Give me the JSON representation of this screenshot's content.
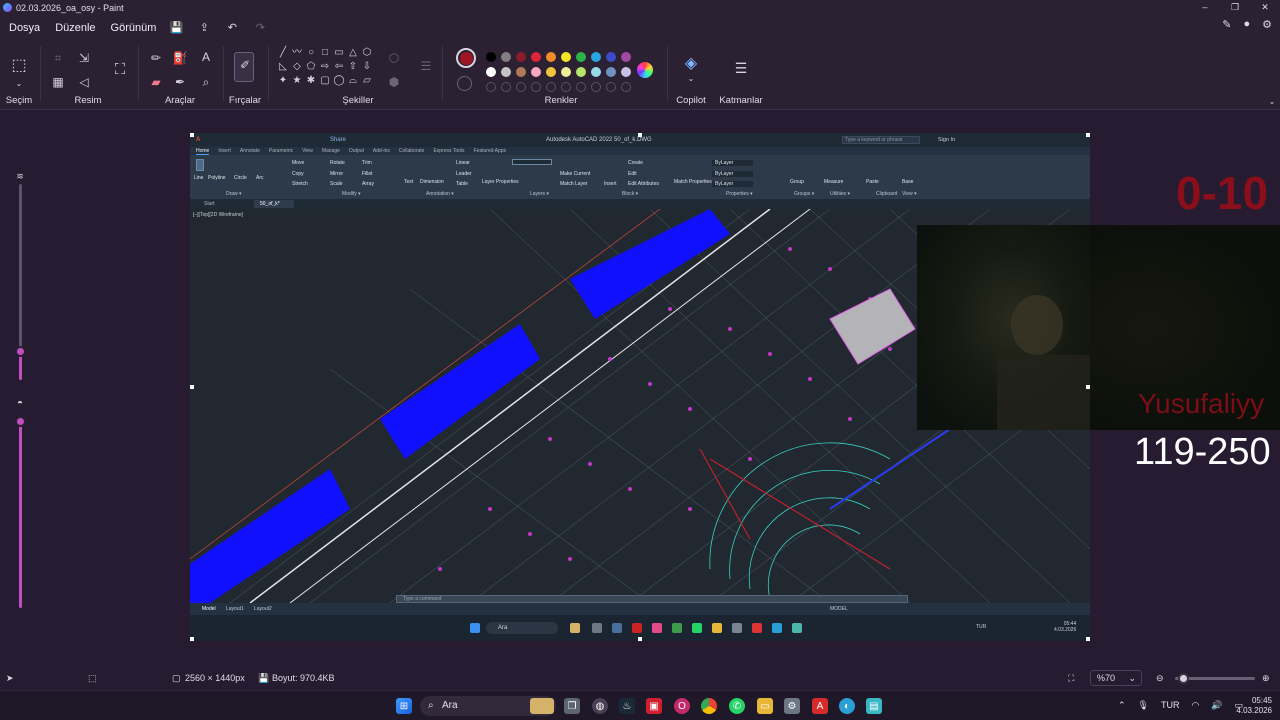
{
  "window": {
    "title": "02.03.2026_oa_osy - Paint",
    "controls": [
      "–",
      "❐",
      "✕"
    ]
  },
  "menu": {
    "items": [
      "Dosya",
      "Düzenle",
      "Görünüm"
    ]
  },
  "ribbon": {
    "groups": {
      "selection": "Seçim",
      "image": "Resim",
      "tools": "Araçlar",
      "brushes": "Fırçalar",
      "shapes": "Şekiller",
      "colors": "Renkler",
      "copilot": "Copilot",
      "layers": "Katmanlar"
    },
    "shape_glyphs": [
      "╱",
      "〰",
      "○",
      "□",
      "▭",
      "△",
      "⬡",
      "◺",
      "◇",
      "⬠",
      "⇨",
      "⇦",
      "⇧",
      "⇩",
      "✦",
      "★",
      "✱",
      "▢",
      "◯",
      "⌓",
      "▱"
    ],
    "primary_color": "#a01428",
    "palette": [
      "#000000",
      "#808080",
      "#8b1a2b",
      "#e0243a",
      "#f28c28",
      "#f7e425",
      "#2cb34a",
      "#27a7e0",
      "#3e4bc8",
      "#a348a3",
      "#ffffff",
      "#c3c3c3",
      "#b07a57",
      "#f7a8c2",
      "#f5c33b",
      "#f0ec9a",
      "#b5e56b",
      "#99d9ea",
      "#7092be",
      "#c8bfe7"
    ]
  },
  "canvas": {
    "autocad": {
      "title": "Autodesk AutoCAD 2022   50_of_k.DWG",
      "search_placeholder": "Type a keyword or phrase",
      "signin": "Sign In",
      "share": "Share",
      "tabs": [
        "Home",
        "Insert",
        "Annotate",
        "Parametric",
        "View",
        "Manage",
        "Output",
        "Add-ins",
        "Collaborate",
        "Express Tools",
        "Featured Apps"
      ],
      "ribbon_groups": [
        "Draw ▾",
        "Modify ▾",
        "Annotation ▾",
        "Layers ▾",
        "Block ▾",
        "Properties ▾",
        "Groups ▾",
        "Utilities ▾",
        "Clipboard",
        "View ▾"
      ],
      "draw_items": [
        "Line",
        "Polyline",
        "Circle",
        "Arc"
      ],
      "modify_items": [
        "Move",
        "Rotate",
        "Trim",
        "Copy",
        "Mirror",
        "Fillet",
        "Stretch",
        "Scale",
        "Array"
      ],
      "annotation_items": [
        "Text",
        "Dimension",
        "Linear",
        "Leader",
        "Table"
      ],
      "layer_items": [
        "Layer Properties",
        "Make Current",
        "Match Layer"
      ],
      "block_items": [
        "Insert",
        "Create",
        "Edit",
        "Edit Attributes"
      ],
      "properties_items": [
        "Match Properties",
        "ByLayer",
        "ByLayer",
        "ByLayer"
      ],
      "other_items": [
        "Group",
        "Measure",
        "Paste",
        "Base"
      ],
      "doc_tabs": {
        "start": "Start",
        "file": "50_of_k*"
      },
      "view_label": "[–][Top][2D Wireframe]",
      "command_placeholder": "Type a command",
      "layout_tabs": [
        "Model",
        "Layout1",
        "Layout2"
      ],
      "status_model": "MODEL",
      "taskbar_search": "Ara",
      "taskbar_lang": "TUR",
      "clock_time": "05:44",
      "clock_date": "4.03.2026"
    },
    "overlay_texts": {
      "range_top": "0-10",
      "name": "Yusufaliyy",
      "range_mid": "119-250"
    }
  },
  "statusbar": {
    "dimensions": "2560 × 1440px",
    "size": "Boyut: 970.4KB",
    "zoom": "%70"
  },
  "taskbar": {
    "search": "Ara",
    "lang": "TUR",
    "time": "05:45",
    "date": "4.03.2026"
  }
}
